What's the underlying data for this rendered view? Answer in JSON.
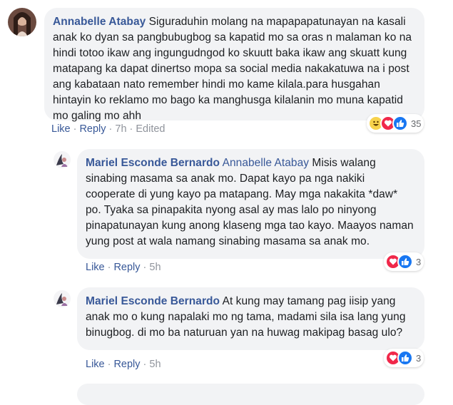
{
  "comments": [
    {
      "author": "Annabelle Atabay",
      "text": " Siguraduhin molang na mapapapatunayan na kasali anak ko dyan sa pangbubugbog sa kapatid mo sa oras n malaman ko na hindi totoo ikaw ang ingungudngod ko skuutt baka ikaw ang skuatt kung matapang ka dapat dinertso mopa sa social media nakakatuwa na i post ang kabataan nato remember hindi mo kame kilala.para husgahan hintayin ko reklamo mo bago ka manghusga kilalanin mo muna kapatid mo galing mo ahh",
      "like_label": "Like",
      "reply_label": "Reply",
      "time": "7h",
      "edited": "Edited",
      "reaction_count": "35",
      "reaction_icons": [
        "haha-icon",
        "love-icon",
        "like-icon"
      ]
    },
    {
      "author": "Mariel Esconde Bernardo",
      "mention": "Annabelle Atabay",
      "text": " Misis walang sinabing masama sa anak mo. Dapat kayo pa nga nakiki cooperate di yung kayo pa matapang. May mga nakakita *daw* po. Tyaka sa pinapakita nyong asal ay mas lalo po ninyong pinapatunayan kung anong klaseng mga tao kayo. Maayos naman yung post at wala namang sinabing masama sa anak mo.",
      "like_label": "Like",
      "reply_label": "Reply",
      "time": "5h",
      "reaction_count": "3",
      "reaction_icons": [
        "love-icon",
        "like-icon"
      ]
    },
    {
      "author": "Mariel Esconde Bernardo",
      "text": " At kung may tamang pag iisip yang anak mo o kung napalaki mo ng tama, madami sila isa lang yung binugbog. di mo ba naturuan yan na huwag makipag basag ulo?",
      "like_label": "Like",
      "reply_label": "Reply",
      "time": "5h",
      "reaction_count": "3",
      "reaction_icons": [
        "love-icon",
        "like-icon"
      ]
    }
  ],
  "colors": {
    "link": "#385898",
    "muted": "#90949c",
    "bubble": "#f2f3f5",
    "like": "#1877f2",
    "love": "#f0284a",
    "haha": "#f7d24c"
  }
}
